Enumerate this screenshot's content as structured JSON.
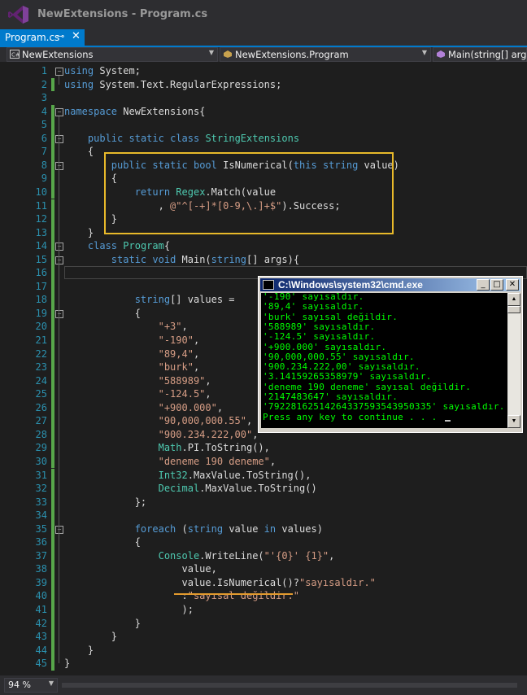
{
  "window": {
    "title": "NewExtensions - Program.cs"
  },
  "tab": {
    "label": "Program.cs",
    "pin_icon": "⊸",
    "close_icon": "✕"
  },
  "navbar": {
    "project": "NewExtensions",
    "class": "NewExtensions.Program",
    "member": "Main(string[] args)"
  },
  "editor": {
    "line_numbers": [
      "1",
      "2",
      "3",
      "4",
      "5",
      "6",
      "7",
      "8",
      "9",
      "10",
      "11",
      "12",
      "13",
      "14",
      "15",
      "16",
      "17",
      "18",
      "19",
      "20",
      "21",
      "22",
      "23",
      "24",
      "25",
      "26",
      "27",
      "28",
      "29",
      "30",
      "31",
      "32",
      "33",
      "34",
      "35",
      "36",
      "37",
      "38",
      "39",
      "40",
      "41",
      "42",
      "43",
      "44",
      "45"
    ]
  },
  "console": {
    "title": "C:\\Windows\\system32\\cmd.exe",
    "lines": [
      "'-190' sayısaldır.",
      "'89,4' sayısaldır.",
      "'burk' sayısal değildir.",
      "'588989' sayısaldır.",
      "'-124.5' sayısaldır.",
      "'+900.000' sayısaldır.",
      "'90,000,000.55' sayısaldır.",
      "'900.234.222,00' sayısaldır.",
      "'3.14159265358979' sayısaldır.",
      "'deneme 190 deneme' sayısal değildir.",
      "'2147483647' sayısaldır.",
      "'79228162514264337593543950335' sayısaldır.",
      "Press any key to continue . . ."
    ]
  },
  "status": {
    "zoom": "94 %"
  },
  "colors": {
    "accent": "#007acc",
    "highlight": "#e8b92a",
    "console_text": "#00ff00"
  }
}
